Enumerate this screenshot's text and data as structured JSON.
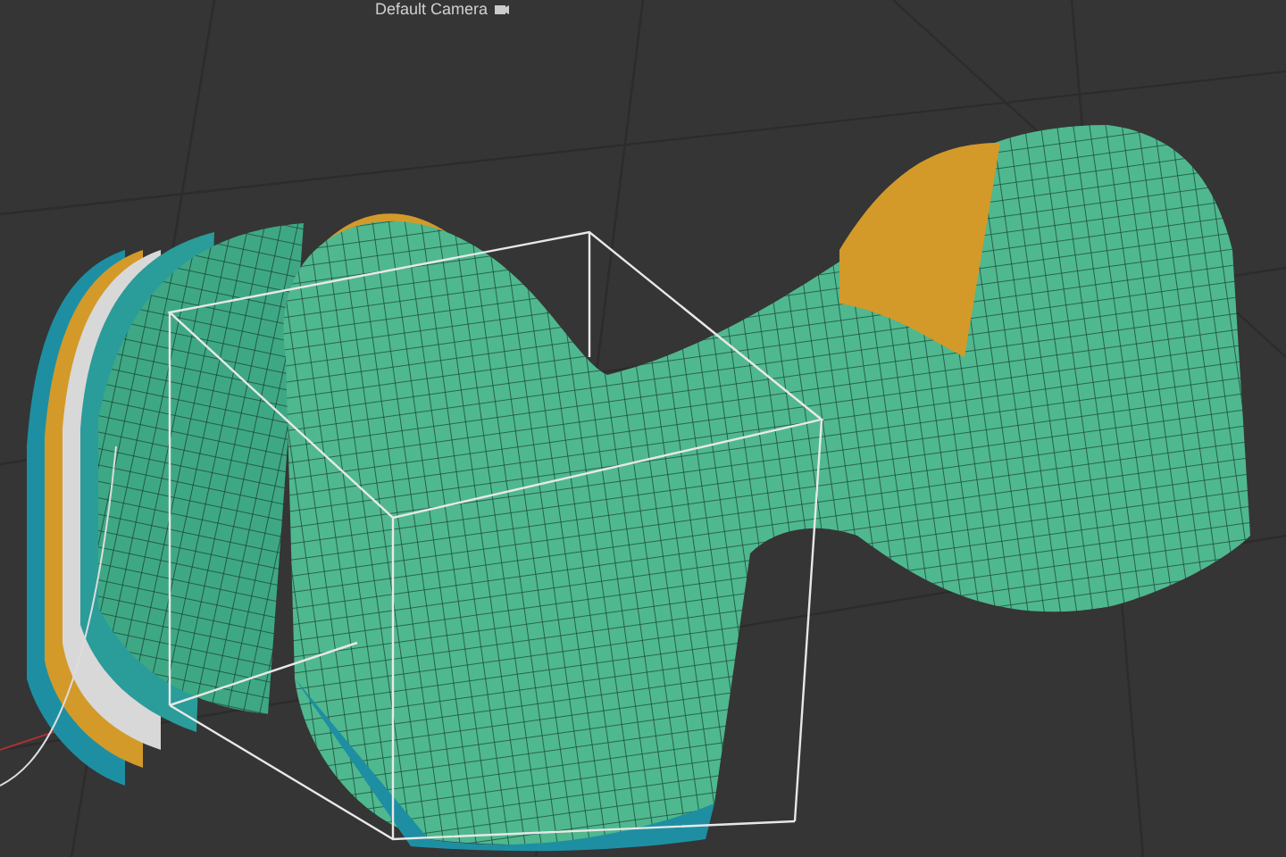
{
  "viewport": {
    "camera_label": "Default Camera"
  }
}
